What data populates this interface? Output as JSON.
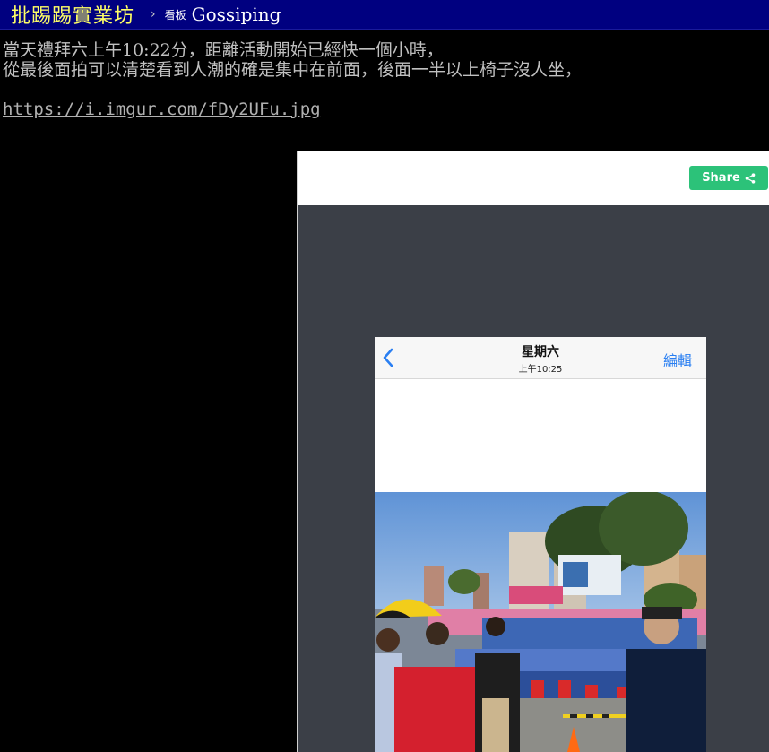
{
  "header": {
    "brand": "批踢踢實業坊",
    "separator": "›",
    "board_prefix": "看板",
    "board_name": "Gossiping"
  },
  "post": {
    "lines": [
      "當天禮拜六上午10:22分，距離活動開始已經快一個小時，",
      "從最後面拍可以清楚看到人潮的確是集中在前面，後面一半以上椅子沒人坐，"
    ],
    "link": "https://i.imgur.com/fDy2UFu.jpg"
  },
  "embed": {
    "share_label": "Share",
    "phone": {
      "title": "星期六",
      "time": "上午10:25",
      "edit_label": "編輯"
    }
  },
  "colors": {
    "topbar_bg": "#000080",
    "brand": "#ffff66",
    "share_button": "#2cc279",
    "ios_link": "#2a7ff2",
    "embed_body": "#3b3f47"
  }
}
